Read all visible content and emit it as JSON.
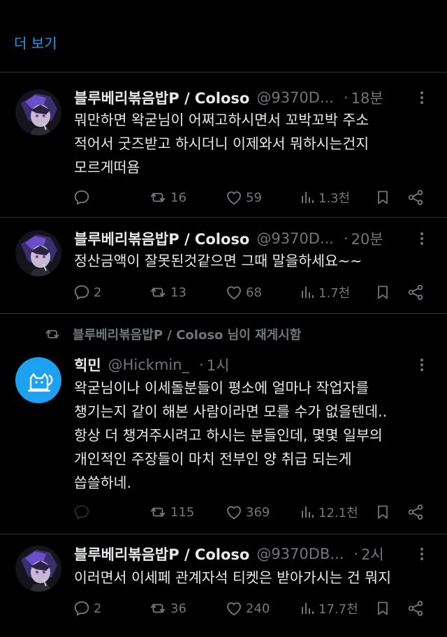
{
  "show_more": {
    "label": "더 보기"
  },
  "repost_banner": {
    "text": "블루베리볶음밥P / Coloso 님이 재게시함"
  },
  "tweets": [
    {
      "name": "블루베리볶음밥P / Coloso",
      "handle": "@9370D...",
      "time": "18분",
      "text": "뭐만하면 왁굳님이 어쩌고하시면서 꼬박꼬박 주소\n적어서 굿즈받고 하시더니 이제와서 뭐하시는건지\n모르게떠욤",
      "replies": "",
      "reposts": "16",
      "likes": "59",
      "views": "1.3천"
    },
    {
      "name": "블루베리볶음밥P / Coloso",
      "handle": "@9370D...",
      "time": "20분",
      "text": "정산금액이 잘못된것같으면 그때 말을하세요~~",
      "replies": "2",
      "reposts": "13",
      "likes": "68",
      "views": "1.7천"
    },
    {
      "name": "힉민",
      "handle": "@Hickmin_",
      "time": "1시",
      "text": "왁굳님이나 이세돌분들이 평소에 얼마나 작업자를\n챙기는지 같이 해본 사람이라면 모를 수가 없을텐데..\n항상 더 챙겨주시려고 하시는 분들인데, 몇몇 일부의\n개인적인 주장들이 마치 전부인 양 취급 되는게\n씁쓸하네.",
      "replies": "",
      "reposts": "115",
      "likes": "369",
      "views": "12.1천"
    },
    {
      "name": "블루베리볶음밥P / Coloso",
      "handle": "@9370DB...",
      "time": "2시",
      "text": "이러면서 이세페 관계자석 티켓은 받아가시는 건 뭐지",
      "replies": "2",
      "reposts": "36",
      "likes": "240",
      "views": "17.7천"
    }
  ],
  "colors": {
    "accent": "#1d9bf0",
    "muted": "#71767b",
    "text": "#e7e9ea",
    "border": "#2f3336",
    "background": "#000000"
  },
  "icons": [
    "reply-icon",
    "repost-icon",
    "like-icon",
    "views-icon",
    "bookmark-icon",
    "share-icon",
    "more-icon"
  ]
}
